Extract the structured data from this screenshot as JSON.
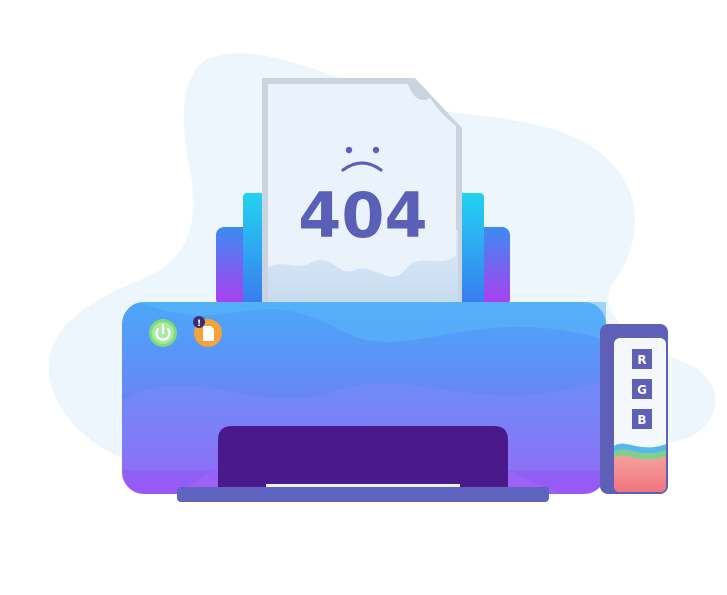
{
  "illustration": {
    "paper": {
      "code": "404",
      "face": "sad-face"
    },
    "printer": {
      "buttons": {
        "power": "power-icon",
        "error": "paper-error-icon",
        "alert": "!"
      }
    },
    "ink_cartridge": {
      "labels": [
        "R",
        "G",
        "B"
      ]
    },
    "colors": {
      "blob": "#EEF6FD",
      "paper": "#EAF3FC",
      "paper_shadow": "#C9D4E0",
      "text": "#5B5FB6",
      "printer_top": "#4FA3F7",
      "printer_bottom": "#9B55F5",
      "slot": "#4A1A8C",
      "tray": "#6064C1",
      "power_button": "#7DDC7A",
      "error_button": "#F6A23A",
      "cartridge_frame": "#5E60B8"
    }
  }
}
